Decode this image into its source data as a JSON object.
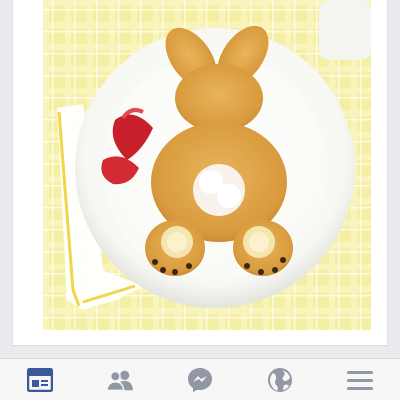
{
  "post": {
    "photo_icon": "bunny-pancake-photo"
  },
  "tabbar": {
    "active_color": "#3b5998",
    "inactive_color": "#9197a3",
    "tabs": [
      {
        "icon": "news-feed-icon",
        "active": true
      },
      {
        "icon": "friend-requests-icon",
        "active": false
      },
      {
        "icon": "messenger-icon",
        "active": false
      },
      {
        "icon": "notifications-globe-icon",
        "active": false
      },
      {
        "icon": "more-menu-icon",
        "active": false
      }
    ]
  }
}
